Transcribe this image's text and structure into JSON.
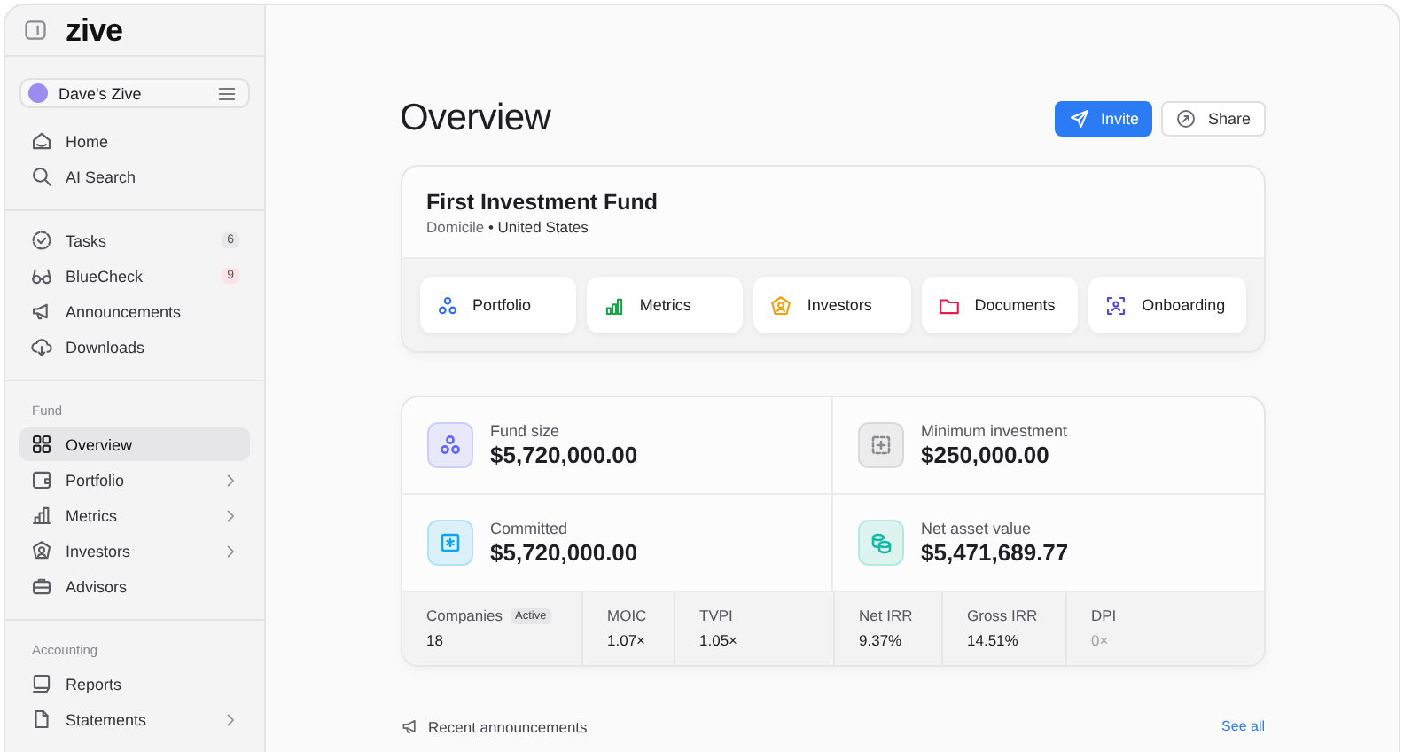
{
  "sidebar": {
    "logo": "zive",
    "workspace": {
      "name": "Dave's Zive"
    },
    "sections": [
      {
        "items": [
          {
            "label": "Home",
            "selected": false,
            "expandable": false
          },
          {
            "label": "AI Search",
            "selected": false,
            "expandable": false
          }
        ]
      },
      {
        "items": [
          {
            "label": "Tasks",
            "selected": false,
            "expandable": false,
            "badge": {
              "text": "6",
              "color": "#e8e8ea"
            }
          },
          {
            "label": "BlueCheck",
            "selected": false,
            "expandable": false,
            "badge": {
              "text": "9",
              "color": "#fde2e6"
            }
          },
          {
            "label": "Announcements",
            "selected": false,
            "expandable": false
          },
          {
            "label": "Downloads",
            "selected": false,
            "expandable": false
          }
        ]
      },
      {
        "heading": "Fund",
        "items": [
          {
            "label": "Overview",
            "selected": true,
            "expandable": false
          },
          {
            "label": "Portfolio",
            "selected": false,
            "expandable": true
          },
          {
            "label": "Metrics",
            "selected": false,
            "expandable": true
          },
          {
            "label": "Investors",
            "selected": false,
            "expandable": true
          },
          {
            "label": "Advisors",
            "selected": false,
            "expandable": false
          }
        ]
      },
      {
        "heading": "Accounting",
        "items": [
          {
            "label": "Reports",
            "selected": false,
            "expandable": false
          },
          {
            "label": "Statements",
            "selected": false,
            "expandable": true
          }
        ]
      }
    ]
  },
  "page": {
    "title": "Overview",
    "buttons": [
      {
        "label": "Invite",
        "kind": "primary"
      },
      {
        "label": "Share",
        "kind": "secondary"
      }
    ]
  },
  "fund": {
    "name": "First Investment Fund",
    "domicile_label": "Domicile",
    "separator": "•",
    "domicile": "United States",
    "links": [
      {
        "label": "Portfolio",
        "color": "#2f6bff"
      },
      {
        "label": "Metrics",
        "color": "#16a34a"
      },
      {
        "label": "Investors",
        "color": "#f59e0b"
      },
      {
        "label": "Documents",
        "color": "#e11d48"
      },
      {
        "label": "Onboarding",
        "color": "#4f46e5"
      }
    ]
  },
  "stats": [
    {
      "label": "Fund size",
      "value": "$5,720,000.00",
      "color": "#6366f1"
    },
    {
      "label": "Minimum investment",
      "value": "$250,000.00",
      "color": "#8a8a90"
    },
    {
      "label": "Committed",
      "value": "$5,720,000.00",
      "color": "#0ea5e9"
    },
    {
      "label": "Net asset value",
      "value": "$5,471,689.77",
      "color": "#14b8a6"
    }
  ],
  "metrics": [
    {
      "label": "Companies",
      "tag": "Active",
      "value": "18",
      "muted": false
    },
    {
      "label": "MOIC",
      "value": "1.07×",
      "muted": false
    },
    {
      "label": "TVPI",
      "value": "1.05×",
      "muted": false
    },
    {
      "label": "Net IRR",
      "value": "9.37%",
      "muted": false
    },
    {
      "label": "Gross IRR",
      "value": "14.51%",
      "muted": false
    },
    {
      "label": "DPI",
      "value": "0×",
      "muted": true
    }
  ],
  "announcements": {
    "title": "Recent announcements",
    "link": "See all"
  }
}
